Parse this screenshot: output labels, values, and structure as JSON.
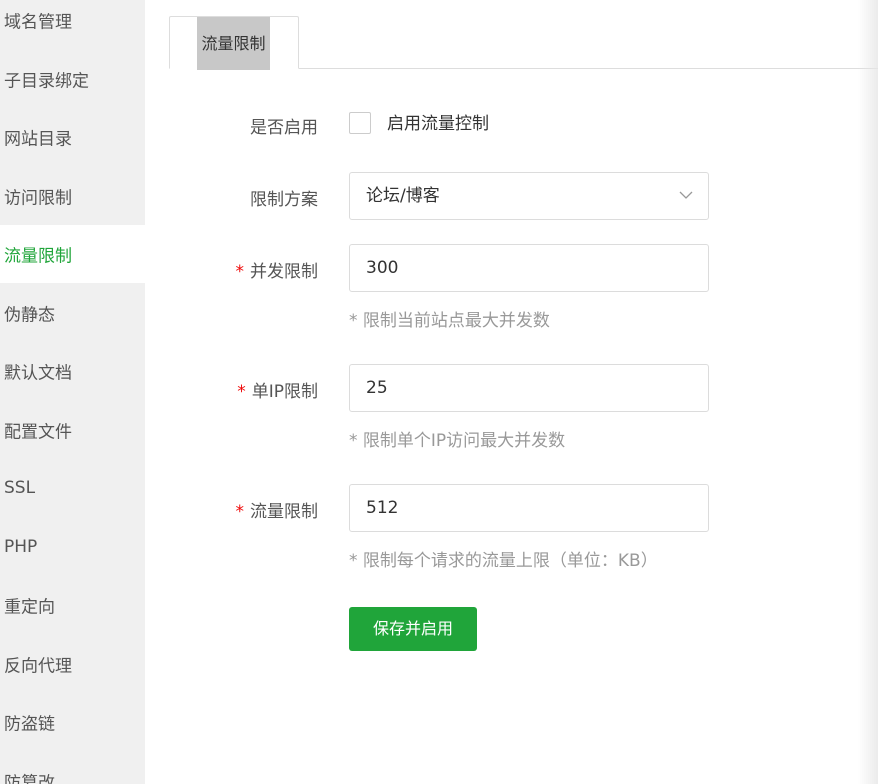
{
  "sidebar": {
    "items": [
      {
        "label": "域名管理"
      },
      {
        "label": "子目录绑定"
      },
      {
        "label": "网站目录"
      },
      {
        "label": "访问限制"
      },
      {
        "label": "流量限制"
      },
      {
        "label": "伪静态"
      },
      {
        "label": "默认文档"
      },
      {
        "label": "配置文件"
      },
      {
        "label": "SSL"
      },
      {
        "label": "PHP"
      },
      {
        "label": "重定向"
      },
      {
        "label": "反向代理"
      },
      {
        "label": "防盗链"
      },
      {
        "label": "防篡改"
      }
    ],
    "active": "流量限制"
  },
  "tabs": [
    {
      "label": "流量限制",
      "active": true
    }
  ],
  "form": {
    "enable": {
      "label": "是否启用",
      "checkbox_label": "启用流量控制",
      "checked": false
    },
    "scheme": {
      "label": "限制方案",
      "selected": "论坛/博客"
    },
    "concurrency": {
      "label": "并发限制",
      "required_mark": "*",
      "value": "300",
      "hint": "* 限制当前站点最大并发数"
    },
    "per_ip": {
      "label": "单IP限制",
      "required_mark": "*",
      "value": "25",
      "hint": "* 限制单个IP访问最大并发数"
    },
    "traffic": {
      "label": "流量限制",
      "required_mark": "*",
      "value": "512",
      "hint": "* 限制每个请求的流量上限（单位：KB）"
    },
    "save_label": "保存并启用"
  },
  "colors": {
    "accent": "#20a53a",
    "required": "#ef0808",
    "sidebar_bg": "#f0f0f0"
  }
}
